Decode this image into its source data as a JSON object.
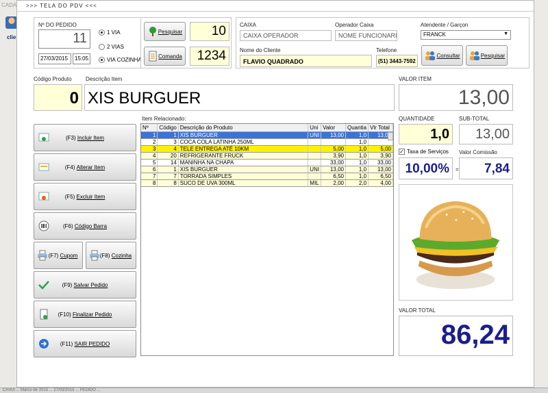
{
  "background_app": {
    "title": "CADA",
    "icon_label": "clie",
    "statusbar": "CAIXA ... Marco de 2015 ... 27/03/2015 ... PEDIDO ..."
  },
  "window": {
    "title": ">>>  TELA DO PDV  <<<"
  },
  "order": {
    "label": "Nº DO PEDIDO",
    "number": "11",
    "date": "27/03/2015",
    "time": "15:05",
    "radios": [
      {
        "label": "1 VIA",
        "checked": true
      },
      {
        "label": "2 VIAS",
        "checked": false
      },
      {
        "label": "VIA COZINHA",
        "checked": true
      }
    ]
  },
  "search": {
    "pesquisar_label": "Pesquisar",
    "pesquisar_value": "10",
    "comanda_label": "Comanda",
    "comanda_value": "1234"
  },
  "caixa": {
    "label": "CAIXA",
    "value": "CAIXA OPERADOR"
  },
  "operador": {
    "label": "Operador Caixa",
    "value": "NOME FUNCIONARIO"
  },
  "atendente": {
    "label": "Atendente / Garçon",
    "value": "FRANCK"
  },
  "cliente": {
    "label": "Nome do Cliente",
    "value": "FLAVIO QUADRADO"
  },
  "telefone": {
    "label": "Telefone",
    "value": "(51) 3443-7592"
  },
  "buttons_top": {
    "consultar": "Consultar",
    "pesquisar": "Pesquisar"
  },
  "product": {
    "code_label": "Código Produto",
    "code_value": "0",
    "desc_label": "Descrição Item",
    "desc_value": "XIS BURGUER"
  },
  "values": {
    "valor_item_label": "VALOR ITEM",
    "valor_item": "13,00",
    "quantidade_label": "QUANTIDADE",
    "quantidade": "1,0",
    "subtotal_label": "SUB-TOTAL",
    "subtotal": "13,00",
    "taxa_label": "Taxa de Serviços",
    "taxa_checked": true,
    "taxa": "10,00%",
    "comissao_label": "Valor Comissão",
    "comissao": "7,84",
    "equals": "=",
    "total_label": "VALOR TOTAL",
    "total": "86,24"
  },
  "actions": [
    {
      "key": "(F3)",
      "label": "Incluir Item"
    },
    {
      "key": "(F4)",
      "label": "Alterar Item"
    },
    {
      "key": "(F5)",
      "label": "Excluir Item"
    },
    {
      "key": "(F6)",
      "label": "Código Barra"
    },
    {
      "key": "(F7)",
      "label": "Cupom"
    },
    {
      "key": "(F8)",
      "label": "Cozinha"
    },
    {
      "key": "(F9)",
      "label": "Salvar Pedido"
    },
    {
      "key": "(F10)",
      "label": "Finalizar Pedido"
    },
    {
      "key": "(F11)",
      "label": "SAIR PEDIDO"
    }
  ],
  "items_table": {
    "label": "Item Relacionado:",
    "headers": [
      "Nº",
      "Código",
      "Descrição do Produto",
      "Uni",
      "Valor",
      "Quantia",
      "Vlr Total"
    ],
    "rows": [
      [
        "1",
        "1",
        "XIS BURGUER",
        "UNI",
        "13,00",
        "1,0",
        "13,00"
      ],
      [
        "2",
        "3",
        "COCA COLA LATINHA 250ML",
        "",
        "",
        "1,0",
        ""
      ],
      [
        "3",
        "4",
        "TELE ENTREGA ATÉ 10KM",
        "",
        "5,00",
        "1,0",
        "5,00"
      ],
      [
        "4",
        "20",
        "REFRIGERANTE FRUCK",
        "",
        "3,90",
        "1,0",
        "3,90"
      ],
      [
        "5",
        "14",
        "MANINHA NA CHAPA",
        "",
        "33,00",
        "1,0",
        "33,00"
      ],
      [
        "6",
        "1",
        "XIS BURGUER",
        "UNI",
        "13,00",
        "1,0",
        "13,00"
      ],
      [
        "7",
        "7",
        "TORRADA SIMPLES",
        "",
        "6,50",
        "1,0",
        "6,50"
      ],
      [
        "8",
        "8",
        "SUCO DE UVA 300ML",
        "MIL",
        "2,00",
        "2,0",
        "4,00"
      ]
    ]
  }
}
